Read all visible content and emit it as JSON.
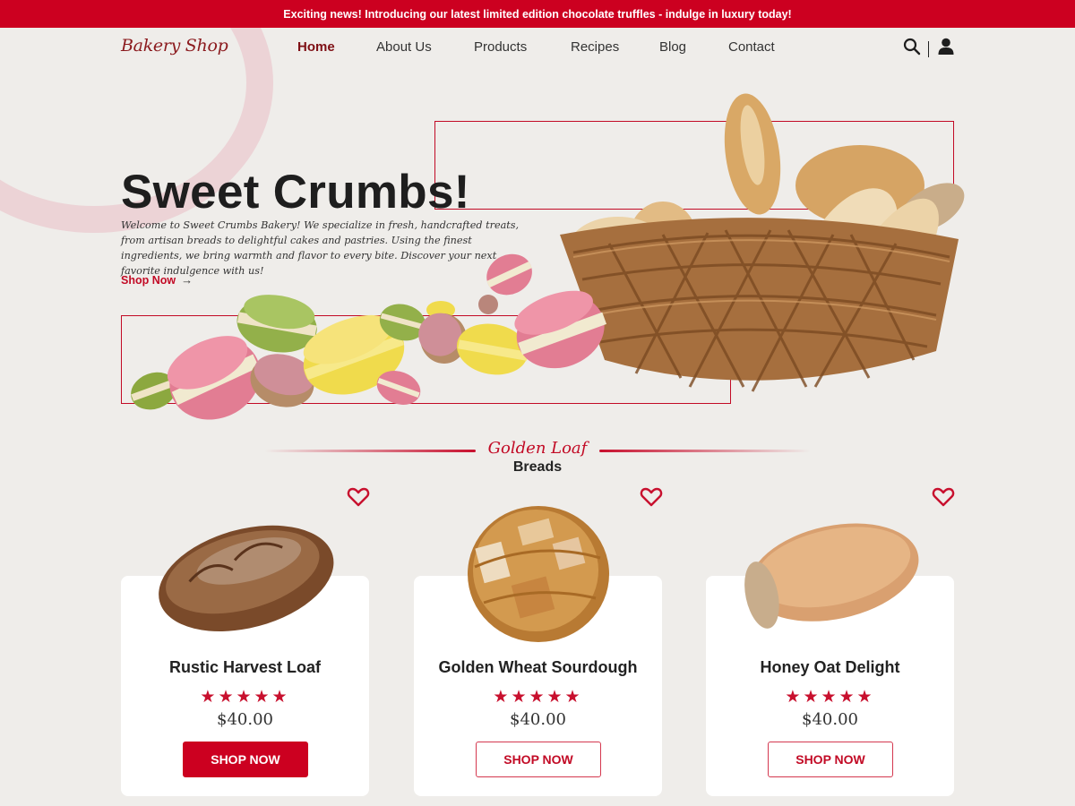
{
  "announcement": "Exciting news! Introducing our latest limited edition chocolate truffles - indulge in luxury today!",
  "brand": {
    "logo": "Bakery Shop",
    "accent_color": "#cc0020",
    "dark_accent": "#7e0f14"
  },
  "nav": {
    "items": [
      {
        "label": "Home",
        "active": true
      },
      {
        "label": "About Us",
        "active": false
      },
      {
        "label": "Products",
        "active": false
      },
      {
        "label": "Recipes",
        "active": false
      },
      {
        "label": "Blog",
        "active": false
      },
      {
        "label": "Contact",
        "active": false
      }
    ],
    "icons": [
      "search-icon",
      "user-icon"
    ]
  },
  "hero": {
    "title": "Sweet Crumbs!",
    "description": "Welcome to Sweet Crumbs Bakery! We specialize in fresh, handcrafted treats, from artisan breads to delightful cakes and pastries. Using the finest ingredients, we bring warmth and flavor to every bite. Discover your next favorite indulgence with us!",
    "cta": "Shop Now",
    "images": [
      "bread basket",
      "macarons"
    ]
  },
  "section": {
    "script_title": "Golden Loaf",
    "subtitle": "Breads"
  },
  "products": [
    {
      "name": "Rustic Harvest Loaf",
      "rating": 5,
      "stars": "★★★★★",
      "price": "$40.00",
      "button": "SHOP NOW",
      "button_style": "filled"
    },
    {
      "name": "Golden Wheat Sourdough",
      "rating": 5,
      "stars": "★★★★★",
      "price": "$40.00",
      "button": "SHOP NOW",
      "button_style": "outline"
    },
    {
      "name": "Honey Oat Delight",
      "rating": 5,
      "stars": "★★★★★",
      "price": "$40.00",
      "button": "SHOP NOW",
      "button_style": "outline"
    }
  ]
}
